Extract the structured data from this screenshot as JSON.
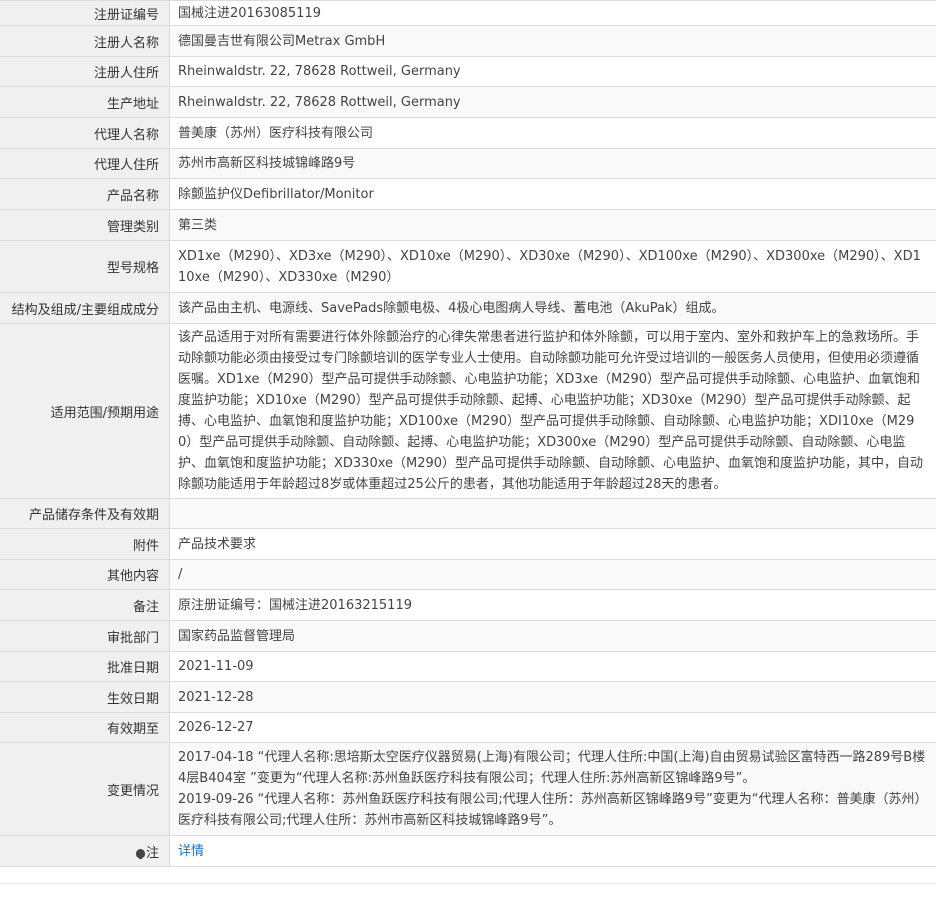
{
  "rows": [
    {
      "label": "注册证编号",
      "value": "国械注进20163085119"
    },
    {
      "label": "注册人名称",
      "value": "德国曼吉世有限公司Metrax GmbH"
    },
    {
      "label": "注册人住所",
      "value": "Rheinwaldstr. 22, 78628 Rottweil, Germany"
    },
    {
      "label": "生产地址",
      "value": "Rheinwaldstr. 22, 78628 Rottweil, Germany"
    },
    {
      "label": "代理人名称",
      "value": "普美康（苏州）医疗科技有限公司"
    },
    {
      "label": "代理人住所",
      "value": "苏州市高新区科技城锦峰路9号"
    },
    {
      "label": "产品名称",
      "value": "除颤监护仪Defibrillator/Monitor"
    },
    {
      "label": "管理类别",
      "value": "第三类"
    },
    {
      "label": "型号规格",
      "value": "XD1xe（M290）、XD3xe（M290）、XD10xe（M290）、XD30xe（M290）、XD100xe（M290）、XD300xe（M290）、XD110xe（M290）、XD330xe（M290）"
    },
    {
      "label": "结构及组成/主要组成成分",
      "value": "该产品由主机、电源线、SavePads除颤电极、4极心电图病人导线、蓄电池（AkuPak）组成。"
    },
    {
      "label": "适用范围/预期用途",
      "value": "该产品适用于对所有需要进行体外除颤治疗的心律失常患者进行监护和体外除颤，可以用于室内、室外和救护车上的急救场所。手动除颤功能必须由接受过专门除颤培训的医学专业人士使用。自动除颤功能可允许受过培训的一般医务人员使用，但使用必须遵循医嘱。XD1xe（M290）型产品可提供手动除颤、心电监护功能；XD3xe（M290）型产品可提供手动除颤、心电监护、血氧饱和度监护功能；XD10xe（M290）型产品可提供手动除颤、起搏、心电监护功能；XD30xe（M290）型产品可提供手动除颤、起搏、心电监护、血氧饱和度监护功能；XD100xe（M290）型产品可提供手动除颤、自动除颤、心电监护功能；XDI10xe（M290）型产品可提供手动除颤、自动除颤、起搏、心电监护功能；XD300xe（M290）型产品可提供手动除颤、自动除颤、心电监护、血氧饱和度监护功能；XD330xe（M290）型产品可提供手动除颤、自动除颤、心电监护、血氧饱和度监护功能，其中，自动除颤功能适用于年龄超过8岁或体重超过25公斤的患者，其他功能适用于年龄超过28天的患者。"
    },
    {
      "label": "产品储存条件及有效期",
      "value": ""
    },
    {
      "label": "附件",
      "value": "产品技术要求"
    },
    {
      "label": "其他内容",
      "value": "/"
    },
    {
      "label": "备注",
      "value": "原注册证编号：国械注进20163215119"
    },
    {
      "label": "审批部门",
      "value": "国家药品监督管理局"
    },
    {
      "label": "批准日期",
      "value": "2021-11-09"
    },
    {
      "label": "生效日期",
      "value": "2021-12-28"
    },
    {
      "label": "有效期至",
      "value": "2026-12-27"
    }
  ],
  "changes": {
    "label": "变更情况",
    "entries": [
      "2017-04-18 “代理人名称:思培斯太空医疗仪器贸易(上海)有限公司；代理人住所:中国(上海)自由贸易试验区富特西一路289号B楼4层B404室 ”变更为“代理人名称:苏州鱼跃医疗科技有限公司；代理人住所:苏州高新区锦峰路9号”。",
      "2019-09-26 “代理人名称：苏州鱼跃医疗科技有限公司;代理人住所：苏州高新区锦峰路9号”变更为“代理人名称：普美康（苏州）医疗科技有限公司;代理人住所：苏州市高新区科技城锦峰路9号”。"
    ]
  },
  "note": {
    "icon": "lightbulb-icon",
    "label": "注",
    "link": "详情",
    "link_color": "#1a72c4"
  }
}
